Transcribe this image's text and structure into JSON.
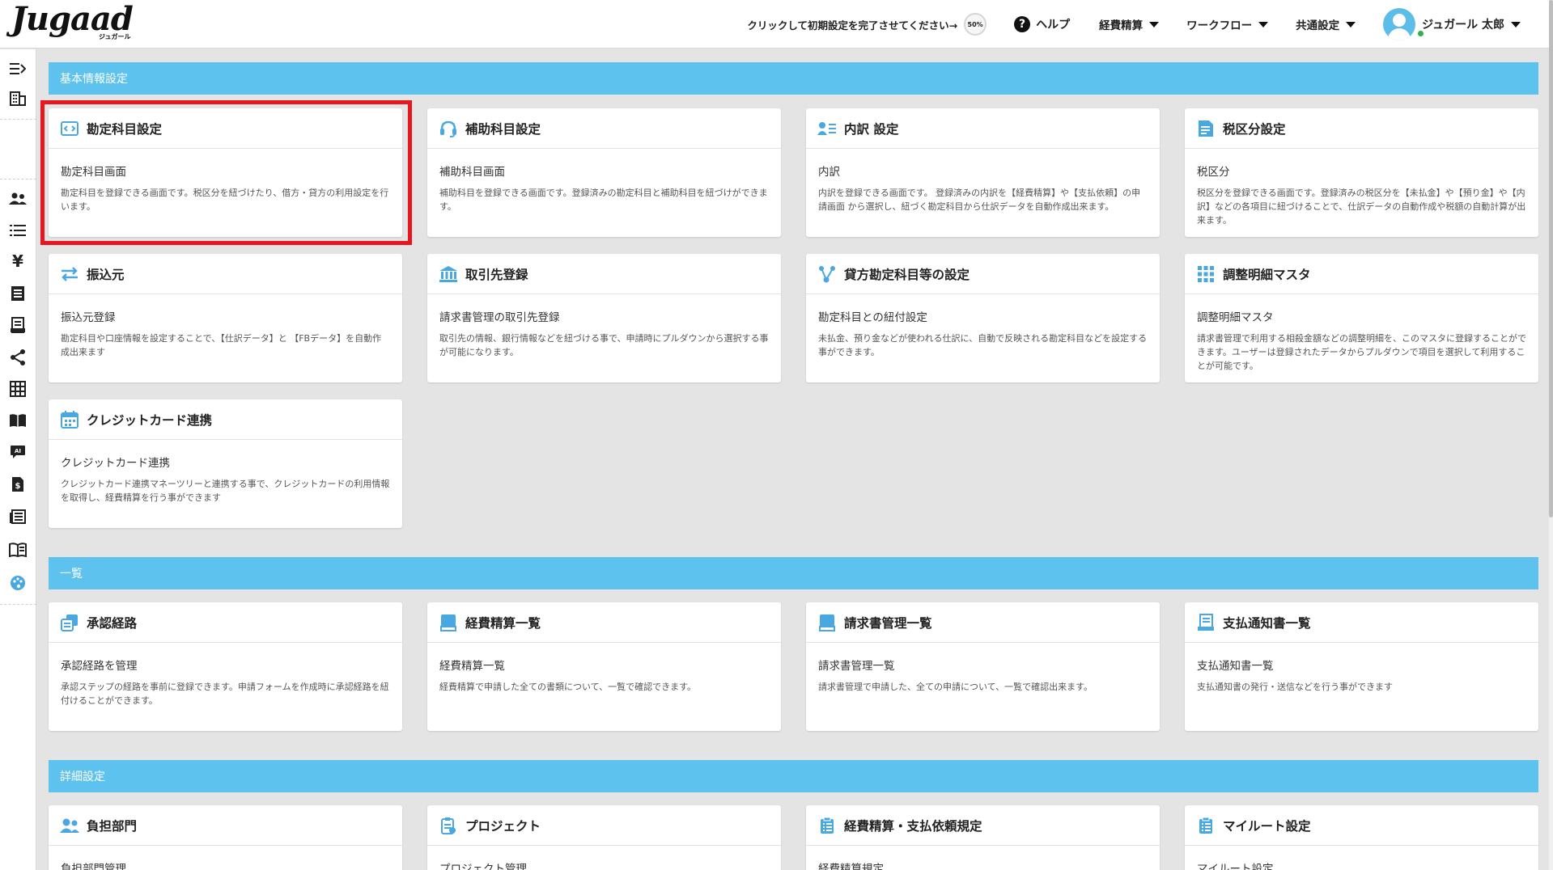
{
  "header": {
    "logo_text": "Jugaad",
    "logo_sub": "ジュガール",
    "setup_prompt": "クリックして初期設定を完了させてください→",
    "setup_progress": "50%",
    "help_label": "ヘルプ",
    "menus": [
      "経費精算",
      "ワークフロー",
      "共通設定"
    ],
    "user_name": "ジュガール 太郎"
  },
  "sidebar": {
    "icons": [
      "menu-toggle-icon",
      "building-icon",
      "users-icon",
      "list-icon",
      "yen-icon",
      "document-icon",
      "receipt-icon",
      "share-icon",
      "grid-icon",
      "book-icon",
      "ai-chat-icon",
      "file-dollar-icon",
      "news-icon",
      "manual-icon",
      "palette-icon"
    ]
  },
  "sections": [
    {
      "title": "基本情報設定",
      "cards": [
        {
          "title": "勘定科目設定",
          "icon": "code-window-icon",
          "subtitle": "勘定科目画面",
          "description": "勘定科目を登録できる画面です。税区分を紐づけたり、借方・貸方の利用設定を行います。"
        },
        {
          "title": "補助科目設定",
          "icon": "headset-icon",
          "subtitle": "補助科目画面",
          "description": "補助科目を登録できる画面です。登録済みの勘定科目と補助科目を紐づけができます。"
        },
        {
          "title": "内訳 設定",
          "icon": "contact-list-icon",
          "subtitle": "内訳",
          "description": "内訳を登録できる画面です。 登録済みの内訳を【経費精算】や【支払依頼】の申請画面 から選択し、紐づく勘定科目から仕訳データを自動作成出来ます。"
        },
        {
          "title": "税区分設定",
          "icon": "tax-document-icon",
          "subtitle": "税区分",
          "description": "税区分を登録できる画面です。登録済みの税区分を【未払金】や【預り金】や【内訳】などの各項目に紐づけることで、仕訳データの自動作成や税額の自動計算が出来ます。"
        },
        {
          "title": "振込元",
          "icon": "transfer-arrows-icon",
          "subtitle": "振込元登録",
          "description": "勘定科目や口座情報を設定することで、【仕訳データ】と 【FBデータ】を自動作成出来ます"
        },
        {
          "title": "取引先登録",
          "icon": "bank-icon",
          "subtitle": "請求書管理の取引先登録",
          "description": "取引先の情報、銀行情報などを紐づける事で、申請時にプルダウンから選択する事が可能になります。"
        },
        {
          "title": "貸方勘定科目等の設定",
          "icon": "connection-icon",
          "subtitle": "勘定科目との紐付設定",
          "description": "未払金、預り金などが使われる仕訳に、自動で反映される勘定科目などを設定する事ができます。"
        },
        {
          "title": "調整明細マスタ",
          "icon": "apps-grid-icon",
          "subtitle": "調整明細マスタ",
          "description": "請求書管理で利用する相殺金額などの調整明細を、このマスタに登録することができます。ユーザーは登録されたデータからプルダウンで項目を選択して利用することが可能です。"
        },
        {
          "title": "クレジットカード連携",
          "icon": "calendar-icon",
          "subtitle": "クレジットカード連携",
          "description": "クレジットカード連携マネーツリーと連携する事で、クレジットカードの利用情報を取得し、経費精算を行う事ができます"
        }
      ]
    },
    {
      "title": "一覧",
      "cards": [
        {
          "title": "承認経路",
          "icon": "approval-route-icon",
          "subtitle": "承認経路を管理",
          "description": "承認ステップの経路を事前に登録できます。申請フォームを作成時に承認経路を紐付けることができます。"
        },
        {
          "title": "経費精算一覧",
          "icon": "book-icon",
          "subtitle": "経費精算一覧",
          "description": "経費精算で申請した全ての書類について、一覧で確認できます。"
        },
        {
          "title": "請求書管理一覧",
          "icon": "book-icon",
          "subtitle": "請求書管理一覧",
          "description": "請求書管理で申請した、全ての申請について、一覧で確認出来ます。"
        },
        {
          "title": "支払通知書一覧",
          "icon": "notice-icon",
          "subtitle": "支払通知書一覧",
          "description": "支払通知書の発行・送信などを行う事ができます"
        }
      ]
    },
    {
      "title": "詳細設定",
      "cards": [
        {
          "title": "負担部門",
          "icon": "users-icon",
          "subtitle": "負担部門管理",
          "description": ""
        },
        {
          "title": "プロジェクト",
          "icon": "project-icon",
          "subtitle": "プロジェクト管理",
          "description": ""
        },
        {
          "title": "経費精算・支払依頼規定",
          "icon": "clipboard-list-icon",
          "subtitle": "経費精算規定",
          "description": ""
        },
        {
          "title": "マイルート設定",
          "icon": "clipboard-list-icon",
          "subtitle": "マイルート設定",
          "description": ""
        }
      ]
    }
  ],
  "colors": {
    "section_bar": "#5ec2ef",
    "icon_blue": "#4aa8e0",
    "highlight_border": "#e8161e",
    "background": "#e4e4e4"
  }
}
